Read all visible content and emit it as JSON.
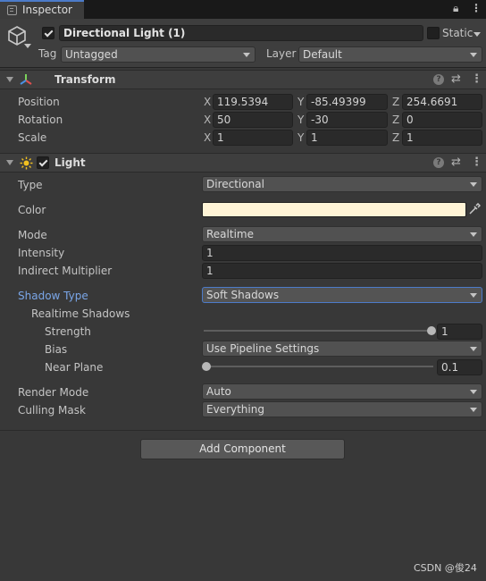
{
  "tab": {
    "title": "Inspector"
  },
  "header": {
    "object_name": "Directional Light (1)",
    "static_label": "Static",
    "tag_label": "Tag",
    "tag_value": "Untagged",
    "layer_label": "Layer",
    "layer_value": "Default",
    "active": true
  },
  "transform": {
    "title": "Transform",
    "position": {
      "label": "Position",
      "x": "119.5394",
      "y": "-85.49399",
      "z": "254.6691"
    },
    "rotation": {
      "label": "Rotation",
      "x": "50",
      "y": "-30",
      "z": "0"
    },
    "scale": {
      "label": "Scale",
      "x": "1",
      "y": "1",
      "z": "1"
    },
    "axis": {
      "x": "X",
      "y": "Y",
      "z": "Z"
    }
  },
  "light": {
    "title": "Light",
    "enabled": true,
    "type": {
      "label": "Type",
      "value": "Directional"
    },
    "color": {
      "label": "Color",
      "value": "#fff4d6"
    },
    "mode": {
      "label": "Mode",
      "value": "Realtime"
    },
    "intensity": {
      "label": "Intensity",
      "value": "1"
    },
    "indirect": {
      "label": "Indirect Multiplier",
      "value": "1"
    },
    "shadow_type": {
      "label": "Shadow Type",
      "value": "Soft Shadows"
    },
    "realtime_shadows": {
      "label": "Realtime Shadows"
    },
    "strength": {
      "label": "Strength",
      "value": "1",
      "fraction": 1.0
    },
    "bias": {
      "label": "Bias",
      "value": "Use Pipeline Settings"
    },
    "near_plane": {
      "label": "Near Plane",
      "value": "0.1",
      "fraction": 0.0
    },
    "render_mode": {
      "label": "Render Mode",
      "value": "Auto"
    },
    "culling_mask": {
      "label": "Culling Mask",
      "value": "Everything"
    }
  },
  "add_component": "Add Component",
  "watermark": "CSDN @俊24"
}
